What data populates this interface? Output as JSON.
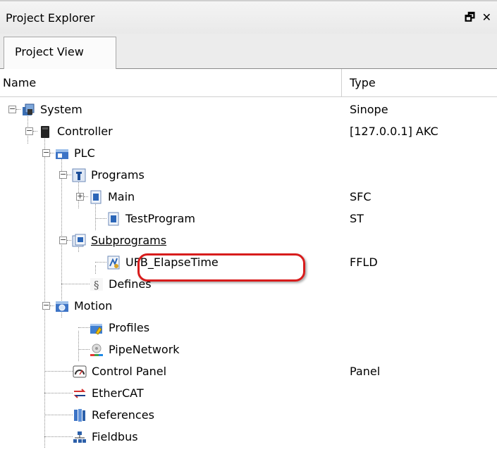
{
  "panel": {
    "title": "Project Explorer",
    "controls": "🗗 ✕",
    "tab": "Project View"
  },
  "columns": {
    "name": "Name",
    "type": "Type"
  },
  "tree": [
    {
      "label": "System",
      "type": "Sinope",
      "icon": "system-icon"
    },
    {
      "label": "Controller",
      "type": "[127.0.0.1] AKC",
      "icon": "controller-icon"
    },
    {
      "label": "PLC",
      "type": "",
      "icon": "plc-icon"
    },
    {
      "label": "Programs",
      "type": "",
      "icon": "programs-icon"
    },
    {
      "label": "Main",
      "type": "SFC",
      "icon": "program-file-icon"
    },
    {
      "label": "TestProgram",
      "type": "ST",
      "icon": "program-file-icon"
    },
    {
      "label": "Subprograms",
      "type": "",
      "icon": "subprograms-icon"
    },
    {
      "label": "UFB_ElapseTime",
      "type": "FFLD",
      "icon": "function-block-icon"
    },
    {
      "label": "Defines",
      "type": "",
      "icon": "defines-icon"
    },
    {
      "label": "Motion",
      "type": "",
      "icon": "motion-icon"
    },
    {
      "label": "Profiles",
      "type": "",
      "icon": "profiles-icon"
    },
    {
      "label": "PipeNetwork",
      "type": "",
      "icon": "pipenetwork-icon"
    },
    {
      "label": "Control Panel",
      "type": "Panel",
      "icon": "control-panel-icon"
    },
    {
      "label": "EtherCAT",
      "type": "",
      "icon": "ethercat-icon"
    },
    {
      "label": "References",
      "type": "",
      "icon": "references-icon"
    },
    {
      "label": "Fieldbus",
      "type": "",
      "icon": "fieldbus-icon"
    }
  ]
}
